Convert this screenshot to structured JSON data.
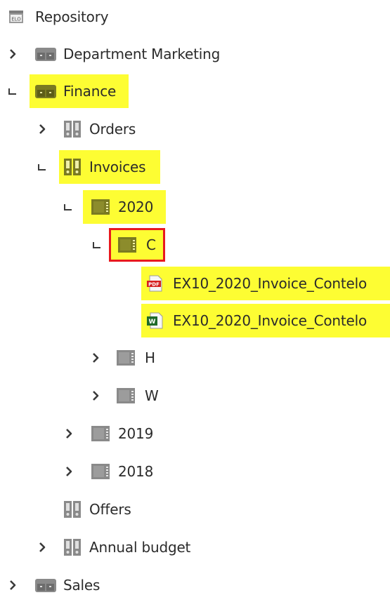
{
  "tree": {
    "root": {
      "label": "Repository",
      "icon": "elo-repository-icon"
    },
    "items": [
      {
        "label": "Department Marketing",
        "icon": "cabinet-icon",
        "state": "collapsed"
      },
      {
        "label": "Finance",
        "icon": "cabinet-icon",
        "state": "expanded",
        "highlighted": true
      },
      {
        "label": "Orders",
        "icon": "binder-icon",
        "state": "collapsed"
      },
      {
        "label": "Invoices",
        "icon": "binder-icon",
        "state": "expanded",
        "highlighted": true
      },
      {
        "label": "2020",
        "icon": "folder-icon",
        "state": "expanded",
        "highlighted": true
      },
      {
        "label": "C",
        "icon": "folder-icon",
        "state": "expanded",
        "highlighted": true,
        "selected": true
      },
      {
        "label": "EX10_2020_Invoice_Contelo",
        "icon": "pdf-file-icon",
        "highlighted": true
      },
      {
        "label": "EX10_2020_Invoice_Contelo",
        "icon": "word-file-icon",
        "highlighted": true
      },
      {
        "label": "H",
        "icon": "folder-icon",
        "state": "collapsed"
      },
      {
        "label": "W",
        "icon": "folder-icon",
        "state": "collapsed"
      },
      {
        "label": "2019",
        "icon": "folder-icon",
        "state": "collapsed"
      },
      {
        "label": "2018",
        "icon": "folder-icon",
        "state": "collapsed"
      },
      {
        "label": "Offers",
        "icon": "binder-icon",
        "state": "leaf"
      },
      {
        "label": "Annual budget",
        "icon": "binder-icon",
        "state": "collapsed"
      },
      {
        "label": "Sales",
        "icon": "cabinet-icon",
        "state": "collapsed"
      }
    ],
    "icon_badges": {
      "repository": "ELO",
      "pdf": "PDF",
      "word": "W"
    }
  },
  "colors": {
    "highlight": "#fdfd33",
    "selection_border": "#e8191e",
    "icon_gray": "#8a8a8a",
    "icon_olive": "#7a7a22"
  }
}
